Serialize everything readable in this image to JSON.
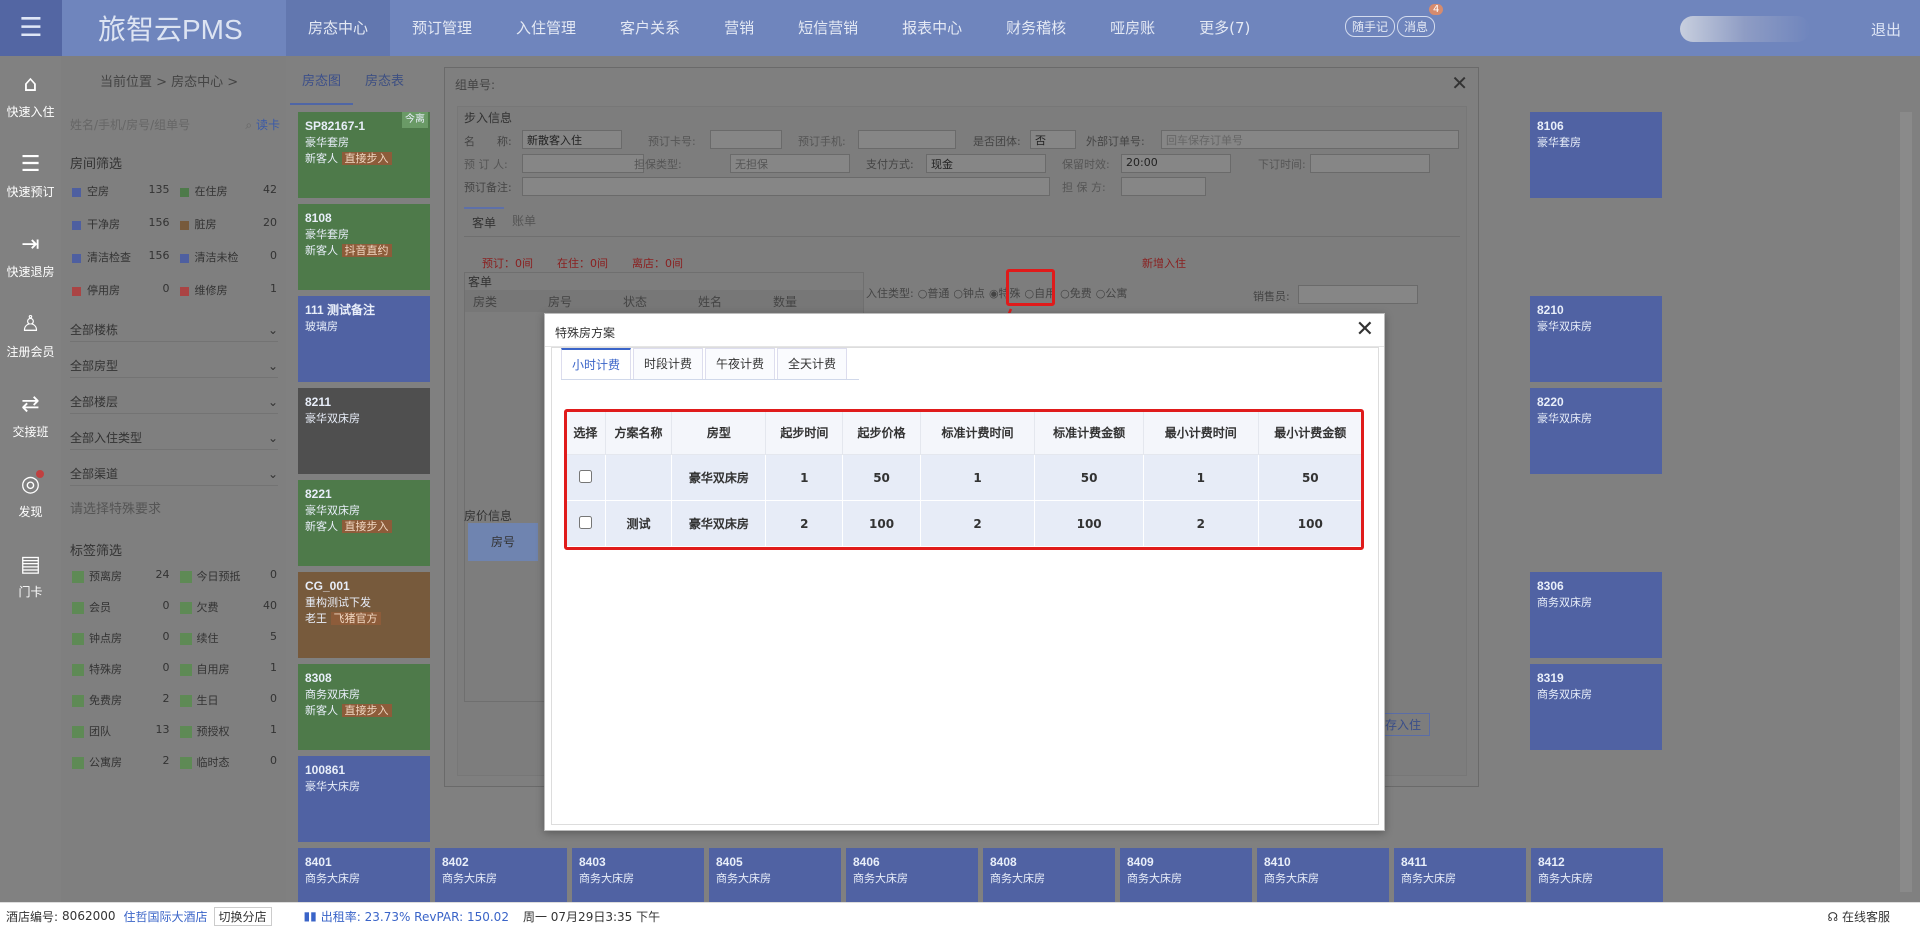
{
  "app": {
    "title": "旅智云PMS",
    "logout": "退出"
  },
  "nav": {
    "items": [
      "房态中心",
      "预订管理",
      "入住管理",
      "客户关系",
      "营销",
      "短信营销",
      "报表中心",
      "财务稽核",
      "哑房账",
      "更多(7)"
    ],
    "notes": "随手记",
    "msg": "消息",
    "msg_count": "4"
  },
  "sidebar": {
    "items": [
      {
        "label": "快速入住",
        "icon": "⌂"
      },
      {
        "label": "快速预订",
        "icon": "☰"
      },
      {
        "label": "快速退房",
        "icon": "⇥"
      },
      {
        "label": "注册会员",
        "icon": "♙"
      },
      {
        "label": "交接班",
        "icon": "⇄"
      },
      {
        "label": "发现",
        "icon": "◎"
      },
      {
        "label": "门卡",
        "icon": "▤"
      }
    ]
  },
  "breadcrumb": "当前位置 > 房态中心 >",
  "view_tabs": [
    "房态图",
    "房态表"
  ],
  "filters": {
    "search_placeholder": "姓名/手机/房号/组单号",
    "read_card": "读卡",
    "room_filter_title": "房间筛选",
    "stats": [
      {
        "label": "空房",
        "count": "135",
        "color": "#4e5fa0"
      },
      {
        "label": "在住房",
        "count": "42",
        "color": "#4e7a4a"
      },
      {
        "label": "干净房",
        "count": "156",
        "color": "#4e5fa0"
      },
      {
        "label": "脏房",
        "count": "20",
        "color": "#775a3c"
      },
      {
        "label": "清洁检查",
        "count": "156",
        "color": "#4e5fa0"
      },
      {
        "label": "清洁未检",
        "count": "0",
        "color": "#4e5fa0"
      },
      {
        "label": "停用房",
        "count": "0",
        "color": "#a44"
      },
      {
        "label": "维修房",
        "count": "1",
        "color": "#a44"
      }
    ],
    "selects": [
      "全部楼栋",
      "全部房型",
      "全部楼层",
      "全部入住类型",
      "全部渠道"
    ],
    "special_placeholder": "请选择特殊要求",
    "tag_title": "标签筛选",
    "tags": [
      {
        "label": "预离房",
        "count": "24"
      },
      {
        "label": "今日预抵",
        "count": "0"
      },
      {
        "label": "会员",
        "count": "0"
      },
      {
        "label": "欠费",
        "count": "40"
      },
      {
        "label": "钟点房",
        "count": "0"
      },
      {
        "label": "续住",
        "count": "5"
      },
      {
        "label": "特殊房",
        "count": "0"
      },
      {
        "label": "自用房",
        "count": "1"
      },
      {
        "label": "免费房",
        "count": "2"
      },
      {
        "label": "生日",
        "count": "0"
      },
      {
        "label": "团队",
        "count": "13"
      },
      {
        "label": "预授权",
        "count": "1"
      },
      {
        "label": "公寓房",
        "count": "2"
      },
      {
        "label": "临时态",
        "count": "0"
      }
    ]
  },
  "rooms_left": [
    {
      "no": "SP82167-1",
      "type": "豪华套房",
      "sub": "新客人",
      "tag": "直接步入",
      "corner": "今离",
      "color": "green"
    },
    {
      "no": "8108",
      "type": "豪华套房",
      "sub": "新客人",
      "tag": "抖音直约",
      "color": "green"
    },
    {
      "no": "111 测试备注",
      "type": "玻璃房",
      "sub": "",
      "tag": "",
      "color": "blue"
    },
    {
      "no": "8211",
      "type": "豪华双床房",
      "sub": "",
      "tag": "",
      "color": "grey"
    },
    {
      "no": "8221",
      "type": "豪华双床房",
      "sub": "新客人",
      "tag": "直接步入",
      "color": "green"
    },
    {
      "no": "CG_001",
      "type": "重构测试下发",
      "sub": "老王",
      "tag": "飞猪官方",
      "color": "brown"
    },
    {
      "no": "8308",
      "type": "商务双床房",
      "sub": "新客人",
      "tag": "直接步入",
      "color": "green"
    },
    {
      "no": "100861",
      "type": "豪华大床房",
      "sub": "",
      "tag": "",
      "color": "blue"
    }
  ],
  "rooms_right": [
    {
      "no": "8106",
      "type": "豪华套房"
    },
    {
      "no": "8210",
      "type": "豪华双床房"
    },
    {
      "no": "8220",
      "type": "豪华双床房"
    },
    {
      "no": "8306",
      "type": "商务双床房"
    },
    {
      "no": "8319",
      "type": "商务双床房"
    }
  ],
  "rooms_bottom": [
    {
      "no": "8401",
      "type": "商务大床房"
    },
    {
      "no": "8402",
      "type": "商务大床房"
    },
    {
      "no": "8403",
      "type": "商务大床房"
    },
    {
      "no": "8405",
      "type": "商务大床房"
    },
    {
      "no": "8406",
      "type": "商务大床房"
    },
    {
      "no": "8408",
      "type": "商务大床房"
    },
    {
      "no": "8409",
      "type": "商务大床房"
    },
    {
      "no": "8410",
      "type": "商务大床房"
    },
    {
      "no": "8411",
      "type": "商务大床房"
    },
    {
      "no": "8412",
      "type": "商务大床房"
    }
  ],
  "checkin_dialog": {
    "title": "组单号:",
    "section": "步入信息",
    "name_label": "名　　称:",
    "name_value": "新散客入住",
    "card_label": "预订卡号:",
    "phone_label": "预订手机:",
    "group_label": "是否团体:",
    "group_value": "否",
    "ext_label": "外部订单号:",
    "ext_placeholder": "回车保存订单号",
    "booker_label": "预 订 人:",
    "guarantee_label": "担保类型:",
    "guarantee_value": "无担保",
    "pay_label": "支付方式:",
    "pay_value": "现金",
    "keep_label": "保留时效:",
    "keep_value": "20:00",
    "order_time_label": "下订时间:",
    "remark_label": "预订备注:",
    "guarantor_label": "担 保 方:",
    "tabs": [
      "客单",
      "账单"
    ],
    "counts": [
      "预订：0间",
      "在住：0间",
      "离店：0间"
    ],
    "new_checkin": "新增入住",
    "guest_title": "客单",
    "guest_cols": [
      "房类",
      "房号",
      "状态",
      "姓名",
      "数量"
    ],
    "checkin_type_label": "入住类型:",
    "checkin_types": [
      "普通",
      "钟点",
      "特殊",
      "自用",
      "免费",
      "公寓"
    ],
    "sales_label": "销售员:",
    "price_title": "房价信息",
    "price_col": "房号",
    "save": "保存入住"
  },
  "special_dialog": {
    "title": "特殊房方案",
    "tabs": [
      "小时计费",
      "时段计费",
      "午夜计费",
      "全天计费"
    ],
    "columns": [
      "选择",
      "方案名称",
      "房型",
      "起步时间",
      "起步价格",
      "标准计费时间",
      "标准计费金额",
      "最小计费时间",
      "最小计费金额"
    ],
    "rows": [
      [
        "",
        "",
        "豪华双床房",
        "1",
        "50",
        "1",
        "50",
        "1",
        "50"
      ],
      [
        "",
        "测试",
        "豪华双床房",
        "2",
        "100",
        "2",
        "100",
        "2",
        "100"
      ]
    ]
  },
  "statusbar": {
    "hotel_label": "酒店编号:",
    "hotel_no": "8062000",
    "hotel_name": "住哲国际大酒店",
    "switch": "切换分店",
    "occ": "出租率: 23.73% RevPAR: 150.02",
    "date": "周一 07月29日3:35 下午",
    "service": "在线客服"
  }
}
